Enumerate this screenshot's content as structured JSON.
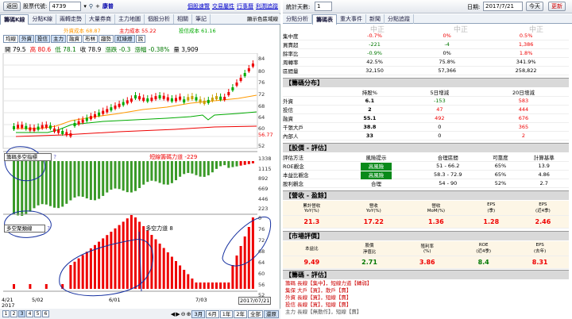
{
  "topbar": {
    "back_label": "返回",
    "stock_label": "股票代號:",
    "stock_code": "4739",
    "stock_name": "康普",
    "links": [
      "個股速覽",
      "交易屬性",
      "行事曆",
      "利潤追蹤"
    ]
  },
  "tabs": [
    "籌碼K線",
    "分點K線",
    "兩轉走勢",
    "大量券商",
    "主力地圖",
    "個股分析",
    "相關",
    "筆記"
  ],
  "tab_right": "顯示色區域線",
  "legend": {
    "a": "外資成本 68.87",
    "b": "主力成本 55.22",
    "c": "投信成本 61.16"
  },
  "toolbar": [
    "均線",
    "外資",
    "投信",
    "主力",
    "融資",
    "布林",
    "趨勢",
    "紅綠燈",
    "說"
  ],
  "price": {
    "open": "開 79.5",
    "high": "高 80.6",
    "low": "低 78.1",
    "close": "收 78.9",
    "chg": "漲跌 -0.3",
    "pct": "漲幅 -0.38%",
    "vol": "量 3,909"
  },
  "axis1": [
    "84",
    "80",
    "76",
    "72",
    "68",
    "64",
    "60",
    "56.77",
    "52"
  ],
  "sub1": {
    "select": "籌碼多空指標",
    "label": "短線籌碼力道 -229"
  },
  "axis2": [
    "1338",
    "1115",
    "892",
    "669",
    "446",
    "223",
    "0"
  ],
  "sub2": {
    "select": "多空聚類線",
    "label": "多空力道 8"
  },
  "axis3": [
    "76",
    "72",
    "68",
    "64",
    "60",
    "56",
    "52"
  ],
  "xaxis": [
    "4/21",
    "5/02",
    "6/01",
    "7/03",
    "2017/07/21"
  ],
  "xyear": "2017",
  "pager": [
    "1",
    "2",
    "3",
    "4",
    "5",
    "6"
  ],
  "zoom": [
    "3月",
    "6月",
    "1年",
    "2年",
    "全部",
    "還原"
  ],
  "rtop": {
    "label": "統計天數:",
    "days": "1",
    "date_label": "日期:",
    "date": "2017/7/21",
    "today": "今天",
    "refresh": "更新"
  },
  "rtabs": [
    "分點分析",
    "籌碼表",
    "重大事件",
    "新聞",
    "分點追蹤"
  ],
  "faded": [
    "中正",
    "中正",
    "中正"
  ],
  "top_rows": [
    {
      "k": "集中度",
      "a": "-0.7%",
      "b": "0%",
      "c": "0.5%"
    },
    {
      "k": "買賣超",
      "a": "-221",
      "b": "-4",
      "c": "1,386"
    },
    {
      "k": "餘率比",
      "a": "-0.9%",
      "b": "0%",
      "c": "1.8%"
    },
    {
      "k": "周轉率",
      "a": "42.5%",
      "b": "75.8%",
      "c": "341.9%"
    },
    {
      "k": "區間量",
      "a": "32,150",
      "b": "57,366",
      "c": "258,822"
    }
  ],
  "sec_dist": "【籌碼分布】",
  "dist_hdr": [
    "持股%",
    "5日增減",
    "20日增減"
  ],
  "dist_rows": [
    {
      "k": "外資",
      "a": "6.1",
      "b": "-153",
      "c": "583"
    },
    {
      "k": "投信",
      "a": "2",
      "b": "47",
      "c": "444"
    },
    {
      "k": "融資",
      "a": "55.1",
      "b": "492",
      "c": "676"
    },
    {
      "k": "千張大戶",
      "a": "38.8",
      "b": "0",
      "c": "365"
    },
    {
      "k": "內部人",
      "a": "33",
      "b": "0",
      "c": "2"
    }
  ],
  "sec_eval": "【股價 - 評估】",
  "eval_hdr": [
    "評估方法",
    "風險提示",
    "合理區間",
    "可靠度",
    "計算基準"
  ],
  "eval_rows": [
    {
      "k": "ROE觀念",
      "r": "高風險",
      "z": "51 - 66.2",
      "p": "65%",
      "c": "13.9"
    },
    {
      "k": "本益比觀念",
      "r": "高風險",
      "z": "58.3 - 72.9",
      "p": "65%",
      "c": "4.86"
    },
    {
      "k": "股利觀念",
      "r": "合理",
      "z": "54 - 90",
      "p": "52%",
      "c": "2.7"
    }
  ],
  "sec_rev": "【營收 - 盈餘】",
  "rev_hdr": [
    "累計營收\nYoY(%)",
    "營收\nYoY(%)",
    "營收\nMoM(%)",
    "EPS\n(季)",
    "EPS\n(近4季)"
  ],
  "rev_vals": [
    "21.3",
    "17.22",
    "1.36",
    "1.28",
    "2.46"
  ],
  "sec_mkt": "【市場評價】",
  "mkt_hdr": [
    "本益比",
    "股價\n淨值比",
    "殖利率\n(%)",
    "ROE\n(近4季)",
    "EPS\n(去年)"
  ],
  "mkt_vals": [
    "9.49",
    "2.71",
    "3.86",
    "8.4",
    "8.31"
  ],
  "sec_chip": "【籌碼 - 評估】",
  "chip_lines": [
    "籌碼 長線【集中】，短線力道【轉弱】",
    "集保 大戶【買】，散戶【賣】",
    "外資 長線【買】，短線【賣】",
    "投信 長線【買】，短線【賣】",
    "主力 長線【無動作】，短線【賣】"
  ]
}
